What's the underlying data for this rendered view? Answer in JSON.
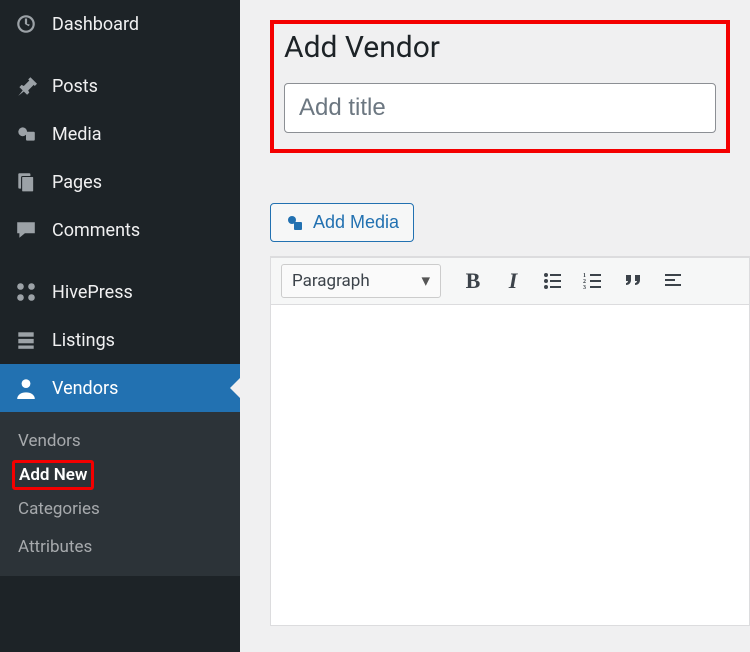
{
  "sidebar": {
    "items": [
      {
        "label": "Dashboard",
        "icon": "dashboard"
      },
      {
        "label": "Posts",
        "icon": "pin"
      },
      {
        "label": "Media",
        "icon": "media"
      },
      {
        "label": "Pages",
        "icon": "pages"
      },
      {
        "label": "Comments",
        "icon": "comment"
      },
      {
        "label": "HivePress",
        "icon": "hivepress"
      },
      {
        "label": "Listings",
        "icon": "listings"
      },
      {
        "label": "Vendors",
        "icon": "vendor"
      }
    ]
  },
  "submenu": {
    "items": [
      {
        "label": "Vendors"
      },
      {
        "label": "Add New"
      },
      {
        "label": "Categories"
      },
      {
        "label": "Attributes"
      }
    ]
  },
  "page": {
    "title": "Add Vendor",
    "title_placeholder": "Add title",
    "add_media": "Add Media"
  },
  "editor": {
    "format_selected": "Paragraph"
  }
}
